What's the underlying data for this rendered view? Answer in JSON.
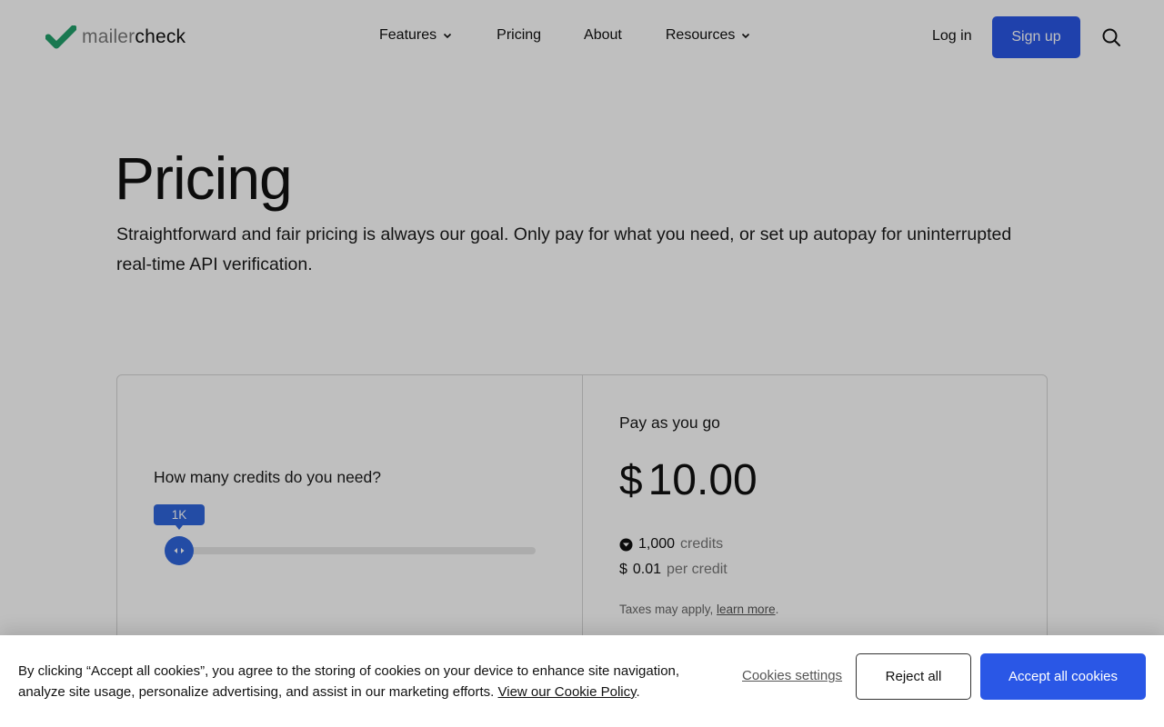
{
  "header": {
    "logo": {
      "part1": "mailer",
      "part2": "check"
    },
    "nav": [
      {
        "label": "Features",
        "has_dropdown": true
      },
      {
        "label": "Pricing",
        "has_dropdown": false
      },
      {
        "label": "About",
        "has_dropdown": false
      },
      {
        "label": "Resources",
        "has_dropdown": true
      }
    ],
    "login_label": "Log in",
    "signup_label": "Sign up",
    "search_icon": "search-icon"
  },
  "hero": {
    "title": "Pricing",
    "subtitle": "Straightforward and fair pricing is always our goal. Only pay for what you need, or set up autopay for uninterrupted real-time API verification."
  },
  "pricing_card": {
    "question": "How many credits do you need?",
    "slider": {
      "tooltip": "1K",
      "value_fraction": 0.0
    },
    "plan_name": "Pay as you go",
    "price_currency": "$",
    "price_amount": "10.00",
    "credits_value": "1,000",
    "credits_unit": "credits",
    "per_credit_currency": "$",
    "per_credit_value": "0.01",
    "per_credit_unit": "per credit",
    "taxes_text": "Taxes may apply, ",
    "taxes_link": "learn more",
    "taxes_end": "."
  },
  "cookie_banner": {
    "text": "By clicking “Accept all cookies”, you agree to the storing of cookies on your device to enhance site navigation, analyze site usage, personalize advertising, and assist in our marketing efforts. ",
    "policy_link": "View our Cookie Policy",
    "policy_end": ".",
    "settings_label": "Cookies settings",
    "reject_label": "Reject all",
    "accept_label": "Accept all cookies"
  },
  "colors": {
    "brand_blue": "#2a57e6",
    "slider_blue": "#2f66dd",
    "logo_green": "#22a06b",
    "overlay": "rgba(0,0,0,0.25)"
  }
}
